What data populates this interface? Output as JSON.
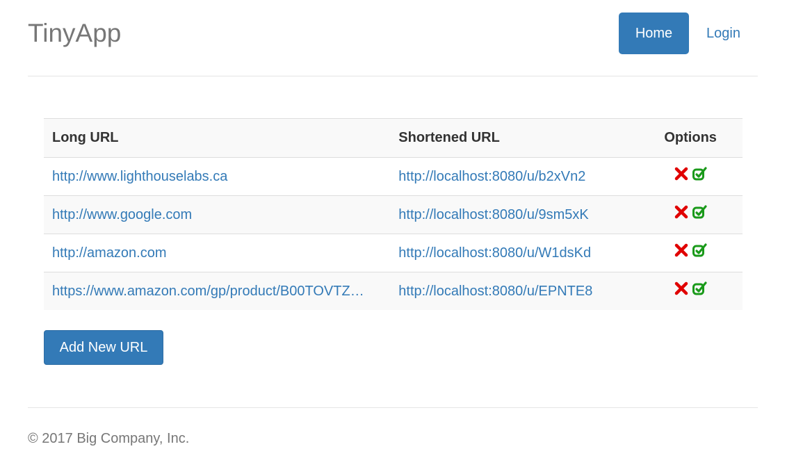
{
  "header": {
    "brand": "TinyApp",
    "nav": {
      "home": "Home",
      "login": "Login"
    }
  },
  "table": {
    "columns": {
      "long_url": "Long URL",
      "short_url": "Shortened URL",
      "options": "Options"
    },
    "rows": [
      {
        "long_url": "http://www.lighthouselabs.ca",
        "short_url": "http://localhost:8080/u/b2xVn2"
      },
      {
        "long_url": "http://www.google.com",
        "short_url": "http://localhost:8080/u/9sm5xK"
      },
      {
        "long_url": "http://amazon.com",
        "short_url": "http://localhost:8080/u/W1dsKd"
      },
      {
        "long_url": "https://www.amazon.com/gp/product/B00TOVTZ…",
        "short_url": "http://localhost:8080/u/EPNTE8"
      }
    ],
    "icons": {
      "delete": "delete-x-icon",
      "edit": "edit-icon"
    }
  },
  "actions": {
    "add_new": "Add New URL"
  },
  "footer": {
    "copyright": "© 2017 Big Company, Inc."
  },
  "colors": {
    "primary": "#337ab7",
    "delete": "#e00000",
    "edit": "#1a9a1a",
    "muted": "#777777"
  }
}
